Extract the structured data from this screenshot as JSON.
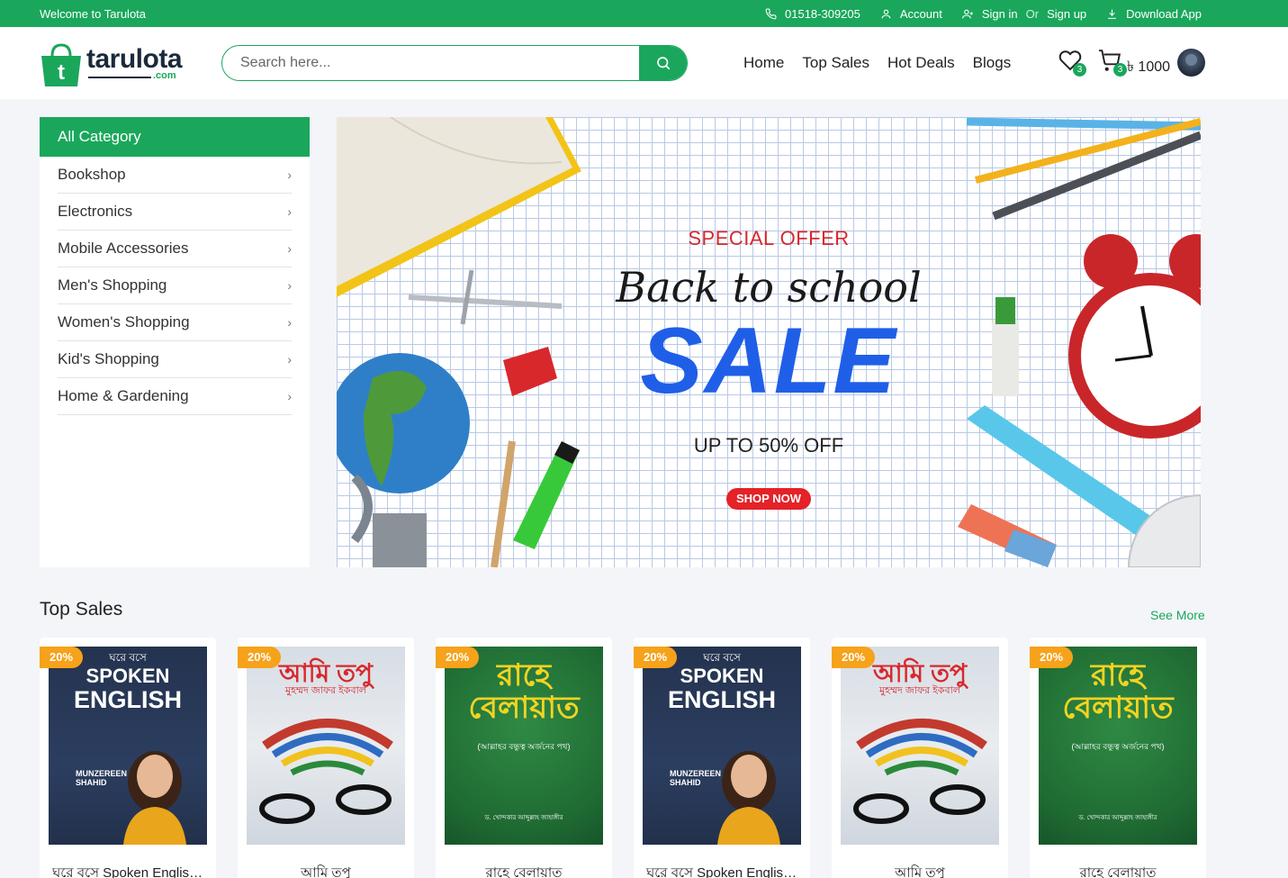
{
  "topbar": {
    "welcome": "Welcome to Tarulota",
    "phone": "01518-309205",
    "account": "Account",
    "sign_in": "Sign in",
    "or": "Or",
    "sign_up": "Sign up",
    "download_app": "Download App"
  },
  "header": {
    "logo_word": "tarulota",
    "logo_suffix": ".com",
    "search_placeholder": "Search here...",
    "nav": [
      "Home",
      "Top Sales",
      "Hot Deals",
      "Blogs"
    ],
    "wishlist_count": "3",
    "cart_count": "3",
    "cart_total": "৳ 1000"
  },
  "sidebar": {
    "title": "All Category",
    "items": [
      "Bookshop",
      "Electronics",
      "Mobile Accessories",
      "Men's Shopping",
      "Women's Shopping",
      "Kid's Shopping",
      "Home & Gardening"
    ]
  },
  "banner": {
    "special": "SPECIAL OFFER",
    "headline": "Back to school",
    "sale": "SALE",
    "subline": "UP TO 50% OFF",
    "cta": "SHOP NOW"
  },
  "top_sales": {
    "title": "Top Sales",
    "see_more": "See More",
    "products": [
      {
        "discount": "20%",
        "name": "ঘরে বসে Spoken English...",
        "cover": "spoken"
      },
      {
        "discount": "20%",
        "name": "আমি তপু",
        "cover": "ami"
      },
      {
        "discount": "20%",
        "name": "রাহে বেলায়াত",
        "cover": "rahe"
      },
      {
        "discount": "20%",
        "name": "ঘরে বসে Spoken English...",
        "cover": "spoken"
      },
      {
        "discount": "20%",
        "name": "আমি তপু",
        "cover": "ami"
      },
      {
        "discount": "20%",
        "name": "রাহে বেলায়াত",
        "cover": "rahe"
      }
    ]
  },
  "covers": {
    "spoken": {
      "line1": "ঘরে বসে",
      "line2": "SPOKEN",
      "line3": "ENGLISH",
      "author": "MUNZEREEN SHAHID"
    },
    "ami": {
      "title": "আমি তপু",
      "author": "মুহম্মদ জাফর ইকবাল"
    },
    "rahe": {
      "title": "রাহে বেলায়াত",
      "subtitle": "(আল্লাহর বন্ধুত্ব অর্জনের পথ)",
      "author": "ড. খোন্দকার আব্দুল্লাহ জাহাঙ্গীর"
    }
  },
  "colors": {
    "brand_green": "#1aa75b",
    "discount_orange": "#f6a21a",
    "sale_blue": "#1f5fe8",
    "offer_red": "#d8282c"
  }
}
